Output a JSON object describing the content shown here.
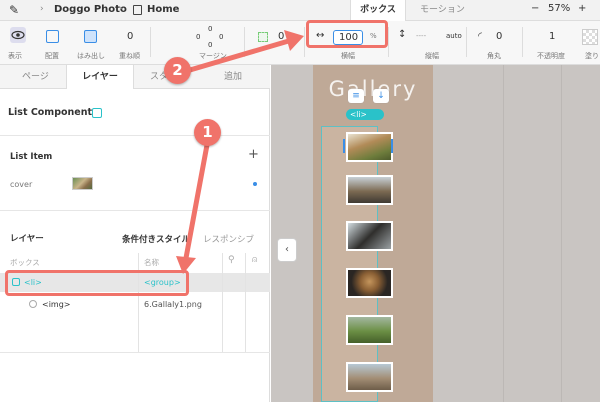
{
  "topbar": {
    "breadcrumb": [
      "Doggo Photo",
      "Home"
    ],
    "tabs": [
      {
        "label": "ボックス",
        "active": true
      },
      {
        "label": "モーション",
        "active": false
      }
    ],
    "zoom_minus": "−",
    "zoom": "57%",
    "zoom_plus": "+"
  },
  "toolbar": {
    "items": [
      {
        "label": "表示",
        "icon": "eye-icon"
      },
      {
        "label": "配置",
        "icon": "align-icon"
      },
      {
        "label": "はみ出し",
        "icon": "overflow-icon"
      },
      {
        "label": "重ね順",
        "value": "0"
      },
      {
        "label": "マージン",
        "values": [
          "0",
          "0",
          "0",
          "0"
        ]
      },
      {
        "label": "",
        "value": "0"
      },
      {
        "label": "横幅",
        "value": "100",
        "unit": "%"
      },
      {
        "label": "縦幅",
        "value": "auto",
        "prefix": "----"
      },
      {
        "label": "角丸",
        "value": "0"
      },
      {
        "label": "不透明度",
        "value": "1"
      },
      {
        "label": "塗り"
      }
    ]
  },
  "panel": {
    "tabs": [
      "ページ",
      "レイヤー",
      "スタ",
      "追加"
    ],
    "active_tab": "レイヤー",
    "component": {
      "title": "List Component"
    },
    "list_item": {
      "title": "List Item",
      "add": "+",
      "cover_label": "cover"
    },
    "layers": {
      "title": "レイヤー",
      "options": [
        "条件付きスタイル",
        "レスポンシブ"
      ],
      "columns": [
        "ボックス",
        "名称"
      ],
      "rows": [
        {
          "box": "<li>",
          "name": "<group>",
          "selected": true
        },
        {
          "box": "<img>",
          "name": "6.Gallaly1.png",
          "selected": false
        }
      ]
    },
    "collapse_icon": "‹"
  },
  "canvas": {
    "gallery_title": "Gallery",
    "li_badge": "<li>",
    "photo_count": 6
  },
  "callouts": [
    "1",
    "2"
  ],
  "colors": {
    "accent": "#3a8ee6",
    "teal": "#2ac2c9",
    "callout": "#f0736a",
    "canvas_bg": "#c9c5c2",
    "gallery_bg": "#bfa997"
  }
}
